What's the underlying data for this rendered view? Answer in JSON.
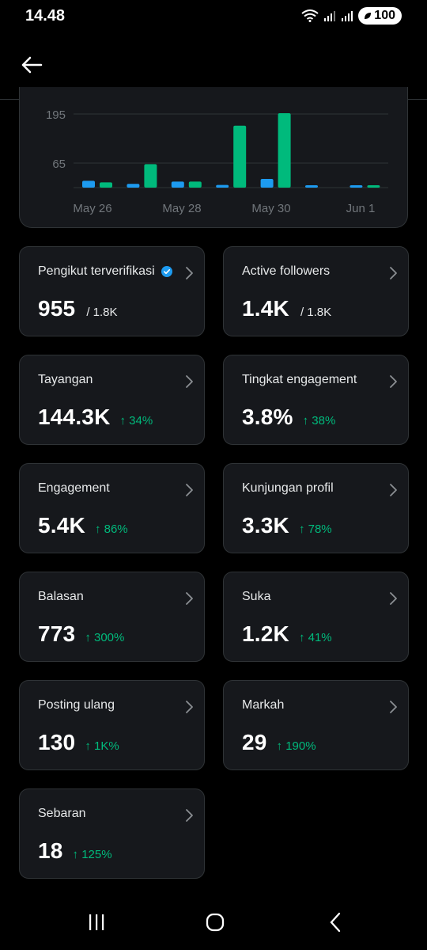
{
  "status_bar": {
    "time": "14.48",
    "battery": "100"
  },
  "header": {
    "back_icon": "arrow-left-icon"
  },
  "chart_data": {
    "type": "bar",
    "title": "",
    "xlabel": "",
    "ylabel": "",
    "ylim": [
      0,
      240
    ],
    "y_ticks": [
      65,
      195
    ],
    "x_tick_labels": [
      "May 26",
      "May 28",
      "May 30",
      "Jun 1"
    ],
    "categories": [
      "May 26",
      "May 27",
      "May 28",
      "May 29",
      "May 30",
      "May 31",
      "Jun 1"
    ],
    "series": [
      {
        "color": "#1d9bf0",
        "values": [
          18,
          10,
          16,
          7,
          23,
          6,
          3
        ]
      },
      {
        "color": "#00ba7c",
        "values": [
          14,
          62,
          16,
          164,
          197,
          0,
          6
        ]
      }
    ],
    "grid": true
  },
  "tiles": [
    {
      "label": "Pengikut terverifikasi",
      "verified": true,
      "value": "955",
      "sub": "/ 1.8K",
      "delta": ""
    },
    {
      "label": "Active followers",
      "verified": false,
      "value": "1.4K",
      "sub": "/ 1.8K",
      "delta": ""
    },
    {
      "label": "Tayangan",
      "verified": false,
      "value": "144.3K",
      "sub": "",
      "delta": "↑ 34%"
    },
    {
      "label": "Tingkat engagement",
      "verified": false,
      "value": "3.8%",
      "sub": "",
      "delta": "↑ 38%"
    },
    {
      "label": "Engagement",
      "verified": false,
      "value": "5.4K",
      "sub": "",
      "delta": "↑ 86%"
    },
    {
      "label": "Kunjungan profil",
      "verified": false,
      "value": "3.3K",
      "sub": "",
      "delta": "↑ 78%"
    },
    {
      "label": "Balasan",
      "verified": false,
      "value": "773",
      "sub": "",
      "delta": "↑ 300%"
    },
    {
      "label": "Suka",
      "verified": false,
      "value": "1.2K",
      "sub": "",
      "delta": "↑ 41%"
    },
    {
      "label": "Posting ulang",
      "verified": false,
      "value": "130",
      "sub": "",
      "delta": "↑ 1K%"
    },
    {
      "label": "Markah",
      "verified": false,
      "value": "29",
      "sub": "",
      "delta": "↑ 190%"
    },
    {
      "label": "Sebaran",
      "verified": false,
      "value": "18",
      "sub": "",
      "delta": "↑ 125%"
    }
  ],
  "nav": {
    "recents_icon": "recents-icon",
    "home_icon": "home-icon",
    "back_icon": "back-icon"
  },
  "colors": {
    "accent": "#1d9bf0",
    "positive": "#00ba7c",
    "card_bg": "#16181c",
    "border": "#2f3336"
  }
}
